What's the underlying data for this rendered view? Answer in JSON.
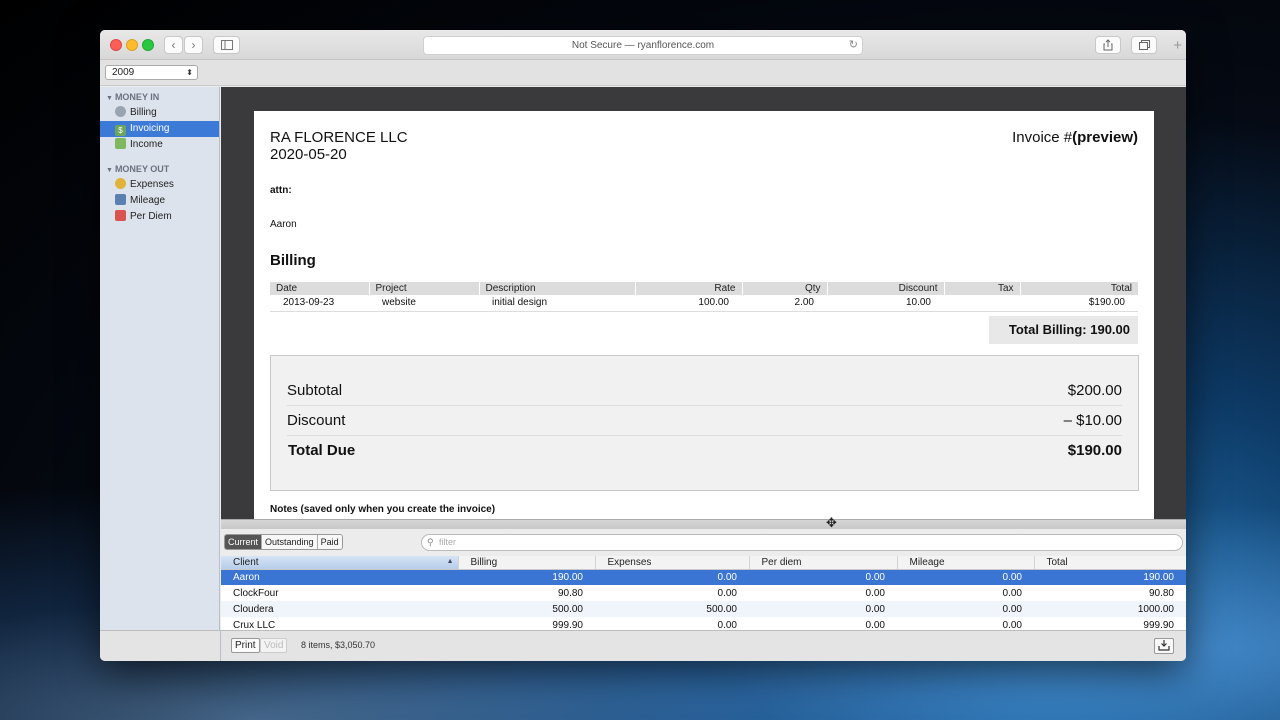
{
  "browser": {
    "url_text": "Not Secure — ryanflorence.com",
    "back": "‹",
    "forward": "›",
    "reload": "↻",
    "new_tab": "+"
  },
  "toolbar": {
    "year": "2009"
  },
  "sidebar": {
    "money_in": "MONEY IN",
    "money_in_items": [
      {
        "label": "Billing",
        "icon": "clock-icon"
      },
      {
        "label": "Invoicing",
        "icon": "dollar-icon"
      },
      {
        "label": "Income",
        "icon": "money-icon"
      }
    ],
    "money_out": "MONEY OUT",
    "money_out_items": [
      {
        "label": "Expenses",
        "icon": "coins-icon"
      },
      {
        "label": "Mileage",
        "icon": "car-icon"
      },
      {
        "label": "Per Diem",
        "icon": "calendar-icon"
      }
    ]
  },
  "invoice": {
    "company": "RA FLORENCE LLC",
    "date": "2020-05-20",
    "invoice_prefix": "Invoice #",
    "invoice_number": "(preview)",
    "attn": "attn:",
    "client": "Aaron",
    "billing_heading": "Billing",
    "columns": [
      "Date",
      "Project",
      "Description",
      "Rate",
      "Qty",
      "Discount",
      "Tax",
      "Total"
    ],
    "rows": [
      {
        "date": "2013-09-23",
        "project": "website",
        "description": "initial design",
        "rate": "100.00",
        "qty": "2.00",
        "discount": "10.00",
        "tax": "",
        "total": "$190.00"
      }
    ],
    "total_billing": "Total Billing: 190.00",
    "subtotal_label": "Subtotal",
    "subtotal": "$200.00",
    "discount_label": "Discount",
    "discount": "– $10.00",
    "total_due_label": "Total Due",
    "total_due": "$190.00",
    "notes": "Notes (saved only when you create the invoice)"
  },
  "filterbar": {
    "tabs": [
      "Current",
      "Outstanding",
      "Paid"
    ],
    "active_tab": "Current",
    "filter_placeholder": "filter"
  },
  "clients": {
    "columns": [
      "Client",
      "Billing",
      "Expenses",
      "Per diem",
      "Mileage",
      "Total"
    ],
    "rows": [
      {
        "client": "Aaron",
        "billing": "190.00",
        "expenses": "0.00",
        "per_diem": "0.00",
        "mileage": "0.00",
        "total": "190.00"
      },
      {
        "client": "ClockFour",
        "billing": "90.80",
        "expenses": "0.00",
        "per_diem": "0.00",
        "mileage": "0.00",
        "total": "90.80"
      },
      {
        "client": "Cloudera",
        "billing": "500.00",
        "expenses": "500.00",
        "per_diem": "0.00",
        "mileage": "0.00",
        "total": "1000.00"
      },
      {
        "client": "Crux LLC",
        "billing": "999.90",
        "expenses": "0.00",
        "per_diem": "0.00",
        "mileage": "0.00",
        "total": "999.90"
      }
    ]
  },
  "status": {
    "print": "Print",
    "void": "Void",
    "summary": "8 items, $3,050.70"
  }
}
